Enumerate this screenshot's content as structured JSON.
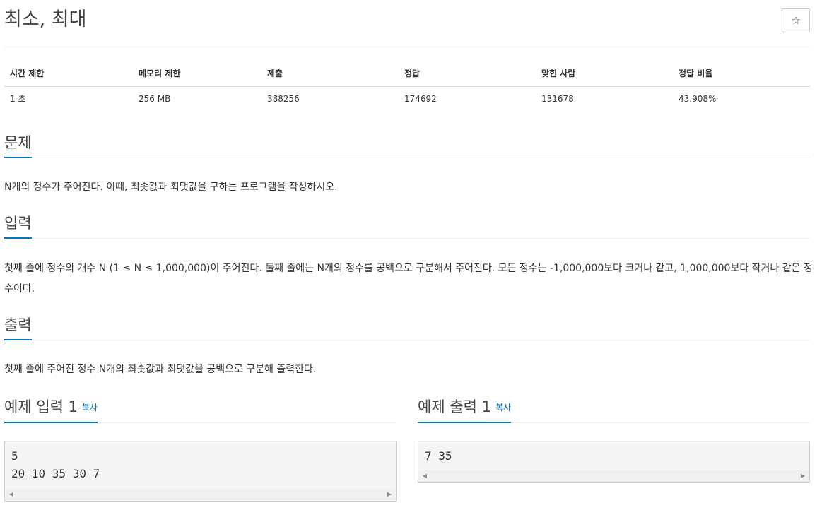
{
  "problem": {
    "title": "최소, 최대",
    "star_label": "☆"
  },
  "info_table": {
    "headers": [
      "시간 제한",
      "메모리 제한",
      "제출",
      "정답",
      "맞힌 사람",
      "정답 비율"
    ],
    "values": [
      "1 초",
      "256 MB",
      "388256",
      "174692",
      "131678",
      "43.908%"
    ]
  },
  "sections": {
    "description": {
      "heading": "문제",
      "text": "N개의 정수가 주어진다. 이때, 최솟값과 최댓값을 구하는 프로그램을 작성하시오."
    },
    "input": {
      "heading": "입력",
      "text": "첫째 줄에 정수의 개수 N (1 ≤ N ≤ 1,000,000)이 주어진다. 둘째 줄에는 N개의 정수를 공백으로 구분해서 주어진다. 모든 정수는 -1,000,000보다 크거나 같고, 1,000,000보다 작거나 같은 정수이다."
    },
    "output": {
      "heading": "출력",
      "text": "첫째 줄에 주어진 정수 N개의 최솟값과 최댓값을 공백으로 구분해 출력한다."
    }
  },
  "samples": {
    "input": {
      "heading": "예제 입력 1",
      "copy_label": "복사",
      "content": "5\n20 10 35 30 7"
    },
    "output": {
      "heading": "예제 출력 1",
      "copy_label": "복사",
      "content": "7 35"
    }
  },
  "colors": {
    "accent": "#0076c0",
    "sample_bg": "#f5f5f5"
  }
}
